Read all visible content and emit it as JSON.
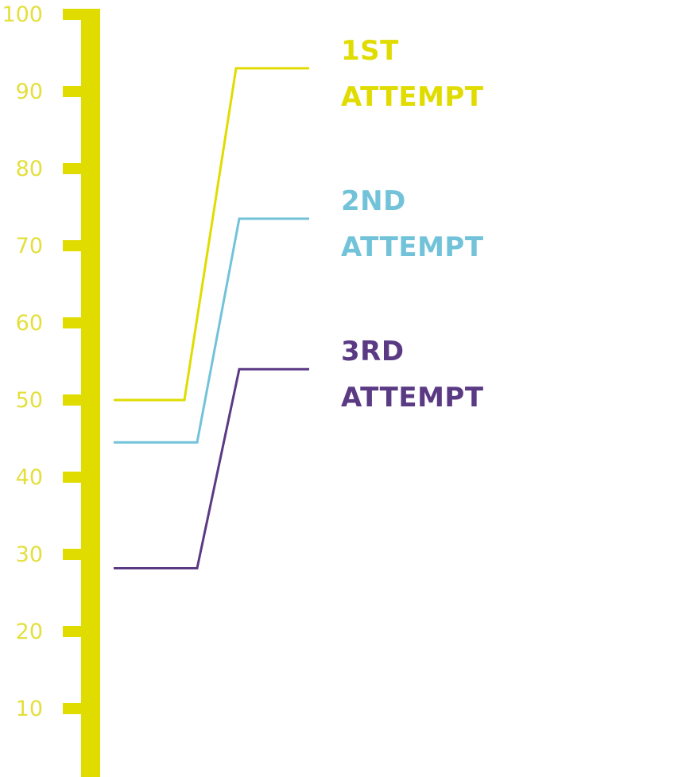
{
  "chart_data": {
    "type": "line",
    "ylim": [
      0,
      100
    ],
    "y_ticks": [
      10,
      20,
      30,
      40,
      50,
      60,
      70,
      80,
      90,
      100
    ],
    "grid": false,
    "legend": "none",
    "series": [
      {
        "name": "1ST\nATTEMPT",
        "label_lines": [
          "1ST",
          "ATTEMPT"
        ],
        "start_value": 50,
        "end_value": 93,
        "color": "#e0dc00"
      },
      {
        "name": "2ND\nATTEMPT",
        "label_lines": [
          "2ND",
          "ATTEMPT"
        ],
        "start_value": 44.5,
        "end_value": 73.5,
        "color": "#72c3d9"
      },
      {
        "name": "3RD\nATTEMPT",
        "label_lines": [
          "3RD",
          "ATTEMPT"
        ],
        "start_value": 28.2,
        "end_value": 54,
        "color": "#5b3a84"
      }
    ],
    "colors": {
      "axis": "#e0dc00",
      "tick_label": "#e3df3c"
    }
  }
}
